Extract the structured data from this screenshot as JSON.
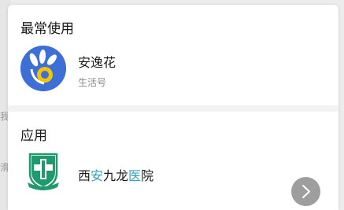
{
  "background": {
    "hint1": "我",
    "hint2": "滑"
  },
  "sections": {
    "frequent": {
      "title": "最常使用",
      "item": {
        "name": "安逸花",
        "subtitle": "生活号"
      }
    },
    "apps": {
      "title": "应用",
      "item": {
        "name_parts": [
          "西",
          "安",
          "九龙",
          "医",
          "院"
        ]
      }
    }
  },
  "icons": {
    "anyihua": "anyihua-logo-icon",
    "hospital": "hospital-emblem-icon",
    "fab": "chevron-right-icon"
  },
  "colors": {
    "avatar_blue": "#3d6fd6",
    "highlight": "#2aa3b8",
    "emblem_green": "#1f9a6d"
  }
}
